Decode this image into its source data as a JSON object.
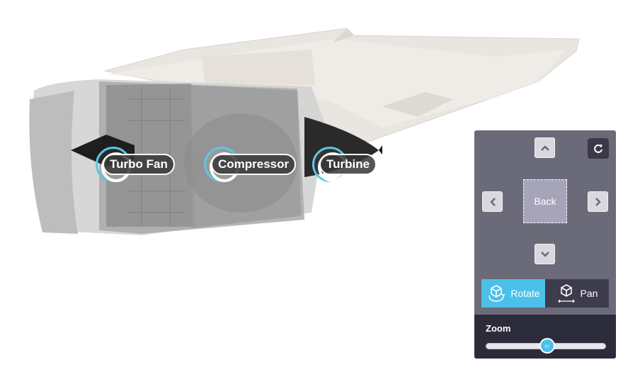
{
  "hotspots": [
    {
      "id": "turbo-fan",
      "label": "Turbo Fan"
    },
    {
      "id": "compressor",
      "label": "Compressor"
    },
    {
      "id": "turbine",
      "label": "Turbine"
    }
  ],
  "controls": {
    "up_icon": "chevron-up-icon",
    "down_icon": "chevron-down-icon",
    "left_icon": "chevron-left-icon",
    "right_icon": "chevron-right-icon",
    "reset_icon": "refresh-icon",
    "view_label": "Back",
    "modes": [
      {
        "label": "Rotate",
        "icon": "rotate-cube-icon",
        "active": true
      },
      {
        "label": "Pan",
        "icon": "pan-cube-icon",
        "active": false
      }
    ],
    "zoom": {
      "label": "Zoom",
      "value": 0.51
    }
  },
  "colors": {
    "accent": "#4bc1ea",
    "panel": "#6b6a78",
    "panel_dark": "#2c2b3a"
  }
}
